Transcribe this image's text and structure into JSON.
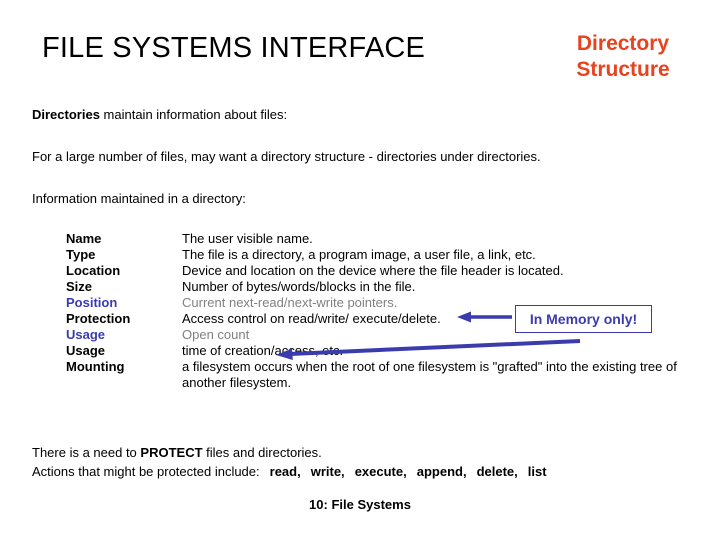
{
  "header": {
    "main_title": "FILE SYSTEMS INTERFACE",
    "subtitle_line1": "Directory",
    "subtitle_line2": "Structure",
    "subtitle_color": "#e8431e"
  },
  "intro": {
    "directories_bold": "Directories",
    "directories_rest": " maintain information about files:",
    "large_number": "For a large number of files, may want a directory structure - directories under directories.",
    "info_maintained": "Information maintained in a directory:"
  },
  "attributes": {
    "rows": [
      {
        "name": "Name",
        "desc": "The user visible name.",
        "name_color": "black",
        "desc_color": "black"
      },
      {
        "name": "Type",
        "desc": "The file is a directory, a program image, a user file, a link, etc.",
        "name_color": "black",
        "desc_color": "black"
      },
      {
        "name": "Location",
        "desc": "Device and location on the device where the file header is located.",
        "name_color": "black",
        "desc_color": "black"
      },
      {
        "name": "Size",
        "desc": "Number of bytes/words/blocks in the file.",
        "name_color": "black",
        "desc_color": "black"
      },
      {
        "name": "Position",
        "desc": "Current next-read/next-write pointers.",
        "name_color": "blue",
        "desc_color": "gray"
      },
      {
        "name": "Protection",
        "desc": "Access control on read/write/ execute/delete.",
        "name_color": "black",
        "desc_color": "black"
      },
      {
        "name": "Usage",
        "desc": "Open count",
        "name_color": "blue",
        "desc_color": "gray"
      },
      {
        "name": "Usage",
        "desc": "time of creation/access, etc.",
        "name_color": "black",
        "desc_color": "black"
      },
      {
        "name": "Mounting",
        "desc": "a filesystem occurs when the root of one filesystem is \"grafted\" into the existing tree of another filesystem.",
        "name_color": "black",
        "desc_color": "black"
      }
    ]
  },
  "callout": {
    "label": "In Memory only!",
    "color": "#3b3bb0"
  },
  "bottom": {
    "protect_prefix": "There is a need to ",
    "protect_bold": "PROTECT",
    "protect_suffix": " files and directories.",
    "actions_prefix": "Actions that might be protected include:",
    "actions": [
      "read,",
      "write,",
      "execute,",
      "append,",
      "delete,",
      "list"
    ]
  },
  "footer": {
    "text": "10: File Systems"
  }
}
